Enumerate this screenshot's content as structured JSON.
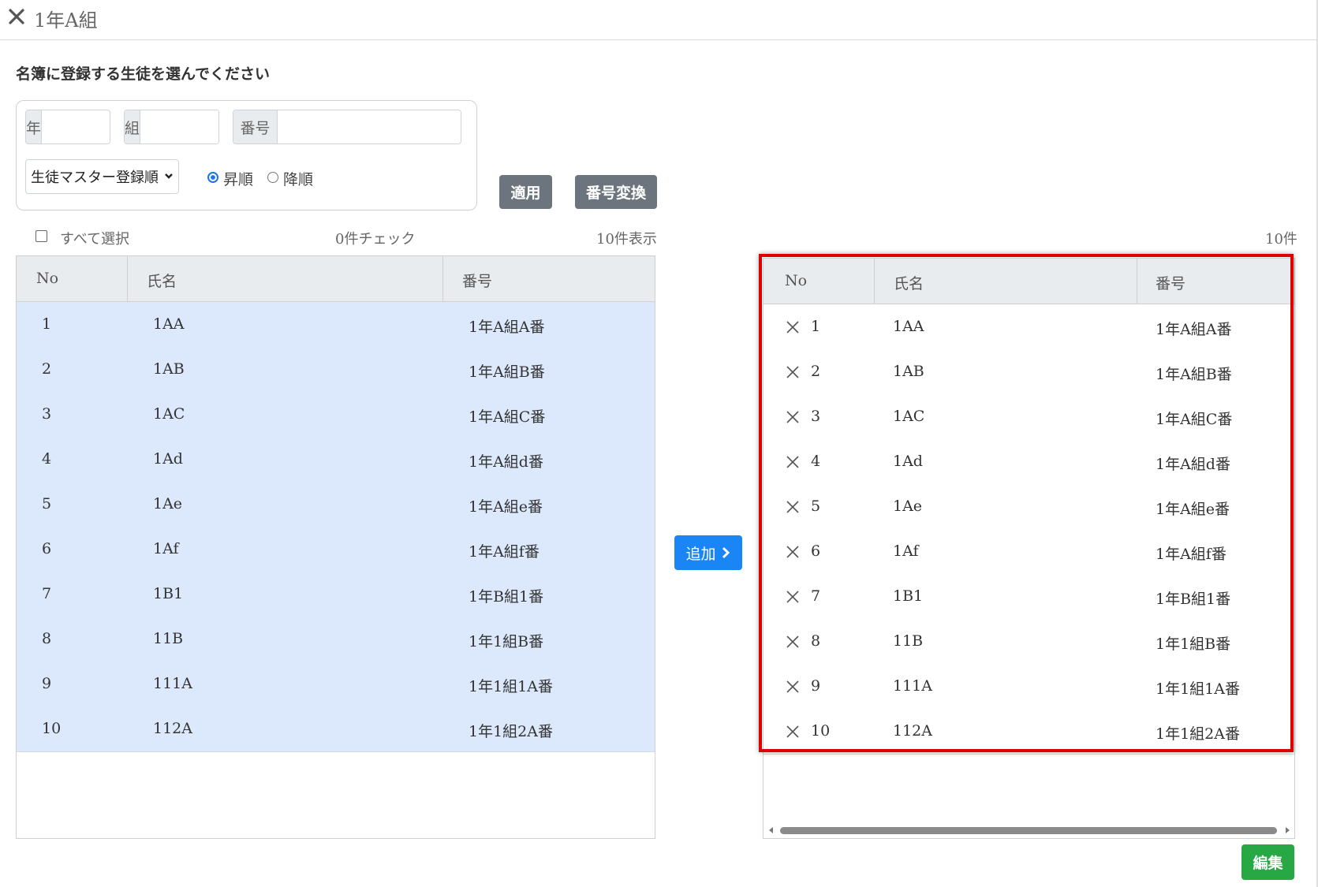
{
  "header": {
    "title": "1年A組"
  },
  "instruction": "名簿に登録する生徒を選んでください",
  "filters": {
    "year_label": "年",
    "class_label": "組",
    "number_label": "番号",
    "sort_select": "生徒マスター登録順",
    "sort_asc": "昇順",
    "sort_desc": "降順",
    "apply_button": "適用",
    "convert_button": "番号変換"
  },
  "left_panel": {
    "select_all": "すべて選択",
    "checked_count": "0件チェック",
    "display_count": "10件表示",
    "columns": [
      "No",
      "氏名",
      "番号"
    ],
    "rows": [
      {
        "no": "1",
        "name": "1AA",
        "number": "1年A組A番"
      },
      {
        "no": "2",
        "name": "1AB",
        "number": "1年A組B番"
      },
      {
        "no": "3",
        "name": "1AC",
        "number": "1年A組C番"
      },
      {
        "no": "4",
        "name": "1Ad",
        "number": "1年A組d番"
      },
      {
        "no": "5",
        "name": "1Ae",
        "number": "1年A組e番"
      },
      {
        "no": "6",
        "name": "1Af",
        "number": "1年A組f番"
      },
      {
        "no": "7",
        "name": "1B1",
        "number": "1年B組1番"
      },
      {
        "no": "8",
        "name": "11B",
        "number": "1年1組B番"
      },
      {
        "no": "9",
        "name": "111A",
        "number": "1年1組1A番"
      },
      {
        "no": "10",
        "name": "112A",
        "number": "1年1組2A番"
      }
    ]
  },
  "add_button": "追加",
  "right_panel": {
    "count": "10件",
    "columns": [
      "No",
      "氏名",
      "番号"
    ],
    "rows": [
      {
        "no": "1",
        "name": "1AA",
        "number": "1年A組A番"
      },
      {
        "no": "2",
        "name": "1AB",
        "number": "1年A組B番"
      },
      {
        "no": "3",
        "name": "1AC",
        "number": "1年A組C番"
      },
      {
        "no": "4",
        "name": "1Ad",
        "number": "1年A組d番"
      },
      {
        "no": "5",
        "name": "1Ae",
        "number": "1年A組e番"
      },
      {
        "no": "6",
        "name": "1Af",
        "number": "1年A組f番"
      },
      {
        "no": "7",
        "name": "1B1",
        "number": "1年B組1番"
      },
      {
        "no": "8",
        "name": "11B",
        "number": "1年1組B番"
      },
      {
        "no": "9",
        "name": "111A",
        "number": "1年1組1A番"
      },
      {
        "no": "10",
        "name": "112A",
        "number": "1年1組2A番"
      }
    ]
  },
  "edit_button": "編集",
  "colors": {
    "selected_row": "#dce8fb",
    "header_bg": "#e9ecef",
    "highlight_frame": "#e00000",
    "primary": "#1a86f5",
    "secondary": "#6c757d",
    "success": "#28a745"
  }
}
